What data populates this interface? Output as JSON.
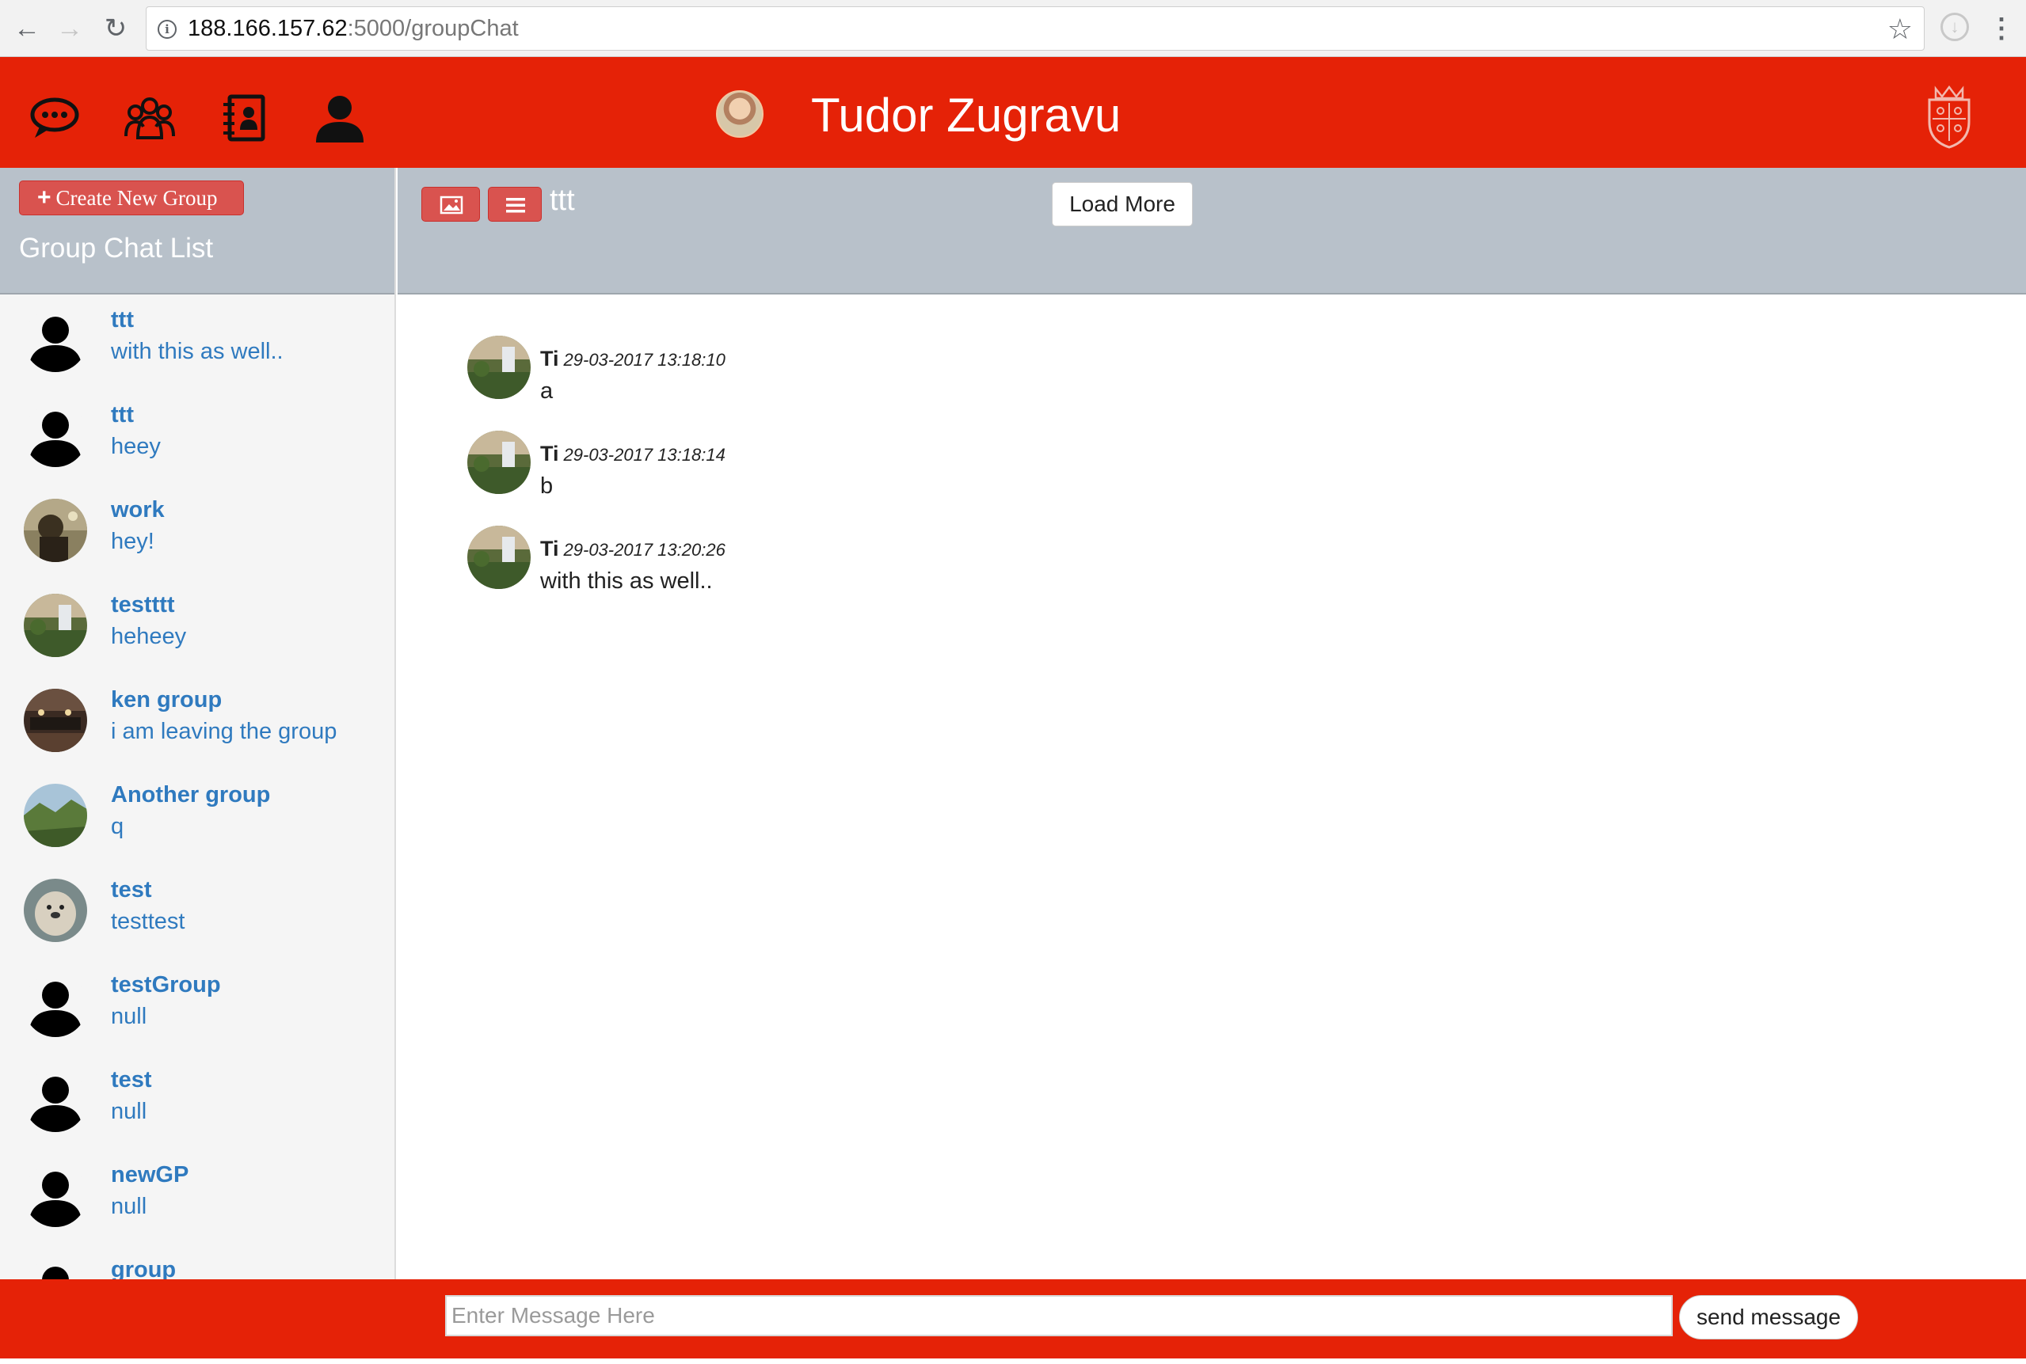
{
  "browser": {
    "url_host": "188.166.157.62",
    "url_path": ":5000/groupChat",
    "back_glyph": "←",
    "forward_glyph": "→",
    "reload_glyph": "↻",
    "star_glyph": "☆",
    "info_glyph": "i",
    "download_glyph": "↓",
    "menu_glyph": "⋮"
  },
  "header": {
    "title": "Tudor Zugravu",
    "icons": [
      "chat-bubble-icon",
      "groups-icon",
      "contacts-book-icon",
      "user-profile-icon"
    ],
    "accent_color": "#e52207"
  },
  "sidebar": {
    "create_button_label": "Create New Group",
    "plus_glyph": "+",
    "list_title": "Group Chat List",
    "groups": [
      {
        "name": "ttt",
        "last_message": "with this as well..",
        "avatar": "default-user"
      },
      {
        "name": "ttt",
        "last_message": "heey",
        "avatar": "default-user"
      },
      {
        "name": "work",
        "last_message": "hey!",
        "avatar": "photo-person"
      },
      {
        "name": "testttt",
        "last_message": "heheey",
        "avatar": "photo-waterfall"
      },
      {
        "name": "ken group",
        "last_message": "i am leaving the group",
        "avatar": "photo-room"
      },
      {
        "name": "Another group",
        "last_message": "q",
        "avatar": "photo-valley"
      },
      {
        "name": "test",
        "last_message": "testtest",
        "avatar": "photo-otter"
      },
      {
        "name": "testGroup",
        "last_message": "null",
        "avatar": "default-user"
      },
      {
        "name": "test",
        "last_message": "null",
        "avatar": "default-user"
      },
      {
        "name": "newGP",
        "last_message": "null",
        "avatar": "default-user"
      },
      {
        "name": "group",
        "last_message": "",
        "avatar": "default-user"
      }
    ]
  },
  "chat": {
    "title": "ttt",
    "load_more_label": "Load More",
    "messages": [
      {
        "sender": "Ti",
        "time": "29-03-2017 13:18:10",
        "text": "a"
      },
      {
        "sender": "Ti",
        "time": "29-03-2017 13:18:14",
        "text": "b"
      },
      {
        "sender": "Ti",
        "time": "29-03-2017 13:20:26",
        "text": "with this as well.."
      }
    ]
  },
  "footer": {
    "input_value": "",
    "input_placeholder": "Enter Message Here",
    "send_label": "send message"
  }
}
